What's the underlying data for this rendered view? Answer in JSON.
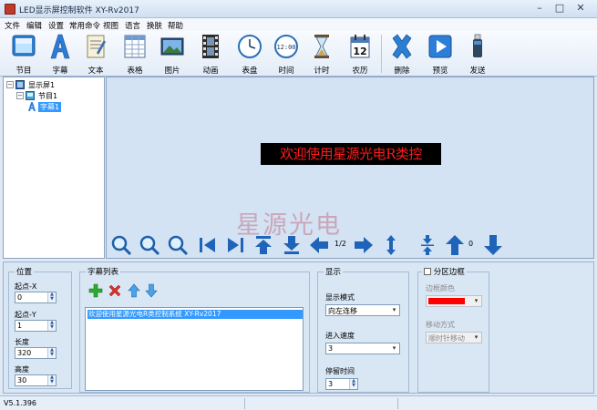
{
  "window": {
    "title": "LED显示屏控制软件 XY-Rv2017",
    "minimize": "–",
    "maximize": "□",
    "close": "✕"
  },
  "menu": [
    "文件",
    "编辑",
    "设置",
    "常用命令",
    "视图",
    "语言",
    "换肤",
    "帮助"
  ],
  "toolbar": [
    {
      "label": "节目",
      "icon": "program-icon"
    },
    {
      "label": "字幕",
      "icon": "subtitle-icon"
    },
    {
      "label": "文本",
      "icon": "text-icon"
    },
    {
      "label": "表格",
      "icon": "table-icon"
    },
    {
      "label": "图片",
      "icon": "picture-icon"
    },
    {
      "label": "动画",
      "icon": "animation-icon"
    },
    {
      "label": "表盘",
      "icon": "clock-dial-icon"
    },
    {
      "label": "时间",
      "icon": "digital-time-icon"
    },
    {
      "label": "计时",
      "icon": "hourglass-icon"
    },
    {
      "label": "农历",
      "icon": "calendar-icon",
      "badge": "12"
    },
    {
      "label": "删除",
      "icon": "delete-icon"
    },
    {
      "label": "预览",
      "icon": "preview-icon"
    },
    {
      "label": "发送",
      "icon": "usb-send-icon"
    }
  ],
  "tree": {
    "screen": "显示屏1",
    "program": "节目1",
    "subtitle": "字幕1",
    "expander_open": "−"
  },
  "preview": {
    "led_text": "欢迎使用星源光电R类控",
    "watermark": "星源光电",
    "page_indicator": "1/2",
    "counter_a": "0",
    "counter_b": "0",
    "colors": {
      "led_bg": "#000000",
      "led_text": "#ff1b1b",
      "preview_bg": "#d3e3f3"
    }
  },
  "position": {
    "title": "位置",
    "start_x_label": "起点-X",
    "start_x": "0",
    "start_y_label": "起点-Y",
    "start_y": "1",
    "length_label": "长度",
    "length": "320",
    "height_label": "高度",
    "height": "30"
  },
  "subtitle_list": {
    "title": "字幕列表",
    "items": [
      "欢迎使用星源光电R类控制系统 XY-Rv2017"
    ]
  },
  "display": {
    "title": "显示",
    "mode_label": "显示模式",
    "mode": "向左连移",
    "speed_label": "进入速度",
    "speed": "3",
    "stay_label": "停留时间",
    "stay": "3"
  },
  "border": {
    "title": "分区边框",
    "checked": false,
    "color_label": "边框颜色",
    "color": "#ff0000",
    "move_label": "移动方式",
    "move": "顺时针移动"
  },
  "status": {
    "version": "V5.1.396"
  }
}
